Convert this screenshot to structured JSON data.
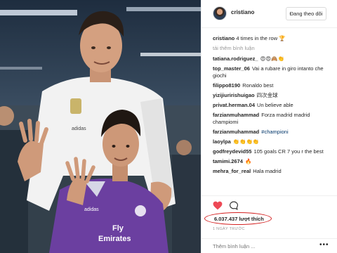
{
  "header": {
    "username": "cristiano",
    "follow_label": "Đang theo dõi"
  },
  "caption": {
    "username": "cristiano",
    "text": "4 times in the row"
  },
  "load_more": "tải thêm bình luận",
  "comments": [
    {
      "user": "tatiana.rodriguez_",
      "text": "😍😍🙈👏"
    },
    {
      "user": "top_master_06",
      "text": "Vai a rubare in giro intanto che giochi"
    },
    {
      "user": "filippo8190",
      "text": "Ronaldo best"
    },
    {
      "user": "yizijiuririshuigao",
      "text": "四次金球"
    },
    {
      "user": "privat.herman.04",
      "text": "Un believe able"
    },
    {
      "user": "farzianmuhammad",
      "text": "Forza madrid madrid champiomi"
    },
    {
      "user": "farzianmuhammad",
      "text": "#championi"
    },
    {
      "user": "laoylpa",
      "text": "👏👏👏👏"
    },
    {
      "user": "godfreydevid55",
      "text": "105 goals CR 7 you r the best"
    },
    {
      "user": "tamimi.2674",
      "text": "🔥"
    },
    {
      "user": "mehra_for_real",
      "text": "Hala madrid"
    }
  ],
  "likes": "6.037.437 lượt thích",
  "time": "1 NGÀY TRƯỚC",
  "add_comment_placeholder": "Thêm bình luận ...",
  "more_label": "•••",
  "icons": {
    "heart": "heart-icon",
    "comment": "comment-bubble-icon",
    "more": "more-options-icon"
  },
  "colors": {
    "heart": "#ed4956",
    "highlight_oval": "#d42020",
    "hashtag": "#003569"
  }
}
